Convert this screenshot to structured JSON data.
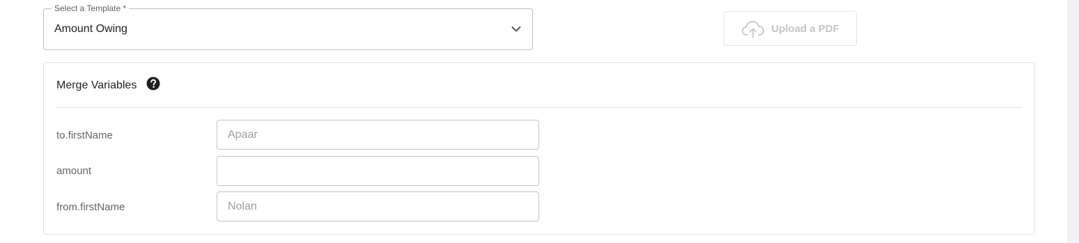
{
  "template_select": {
    "label": "Select a Template *",
    "value": "Amount Owing",
    "icon": "chevron-down-icon"
  },
  "upload": {
    "label": "Upload a PDF",
    "icon": "cloud-upload-icon",
    "color": "#c4c4c4"
  },
  "merge_variables": {
    "title": "Merge Variables",
    "help_icon": "help-circle-icon",
    "rows": [
      {
        "label": "to.firstName",
        "placeholder": "Apaar",
        "value": ""
      },
      {
        "label": "amount",
        "placeholder": "",
        "value": ""
      },
      {
        "label": "from.firstName",
        "placeholder": "Nolan",
        "value": ""
      }
    ]
  }
}
